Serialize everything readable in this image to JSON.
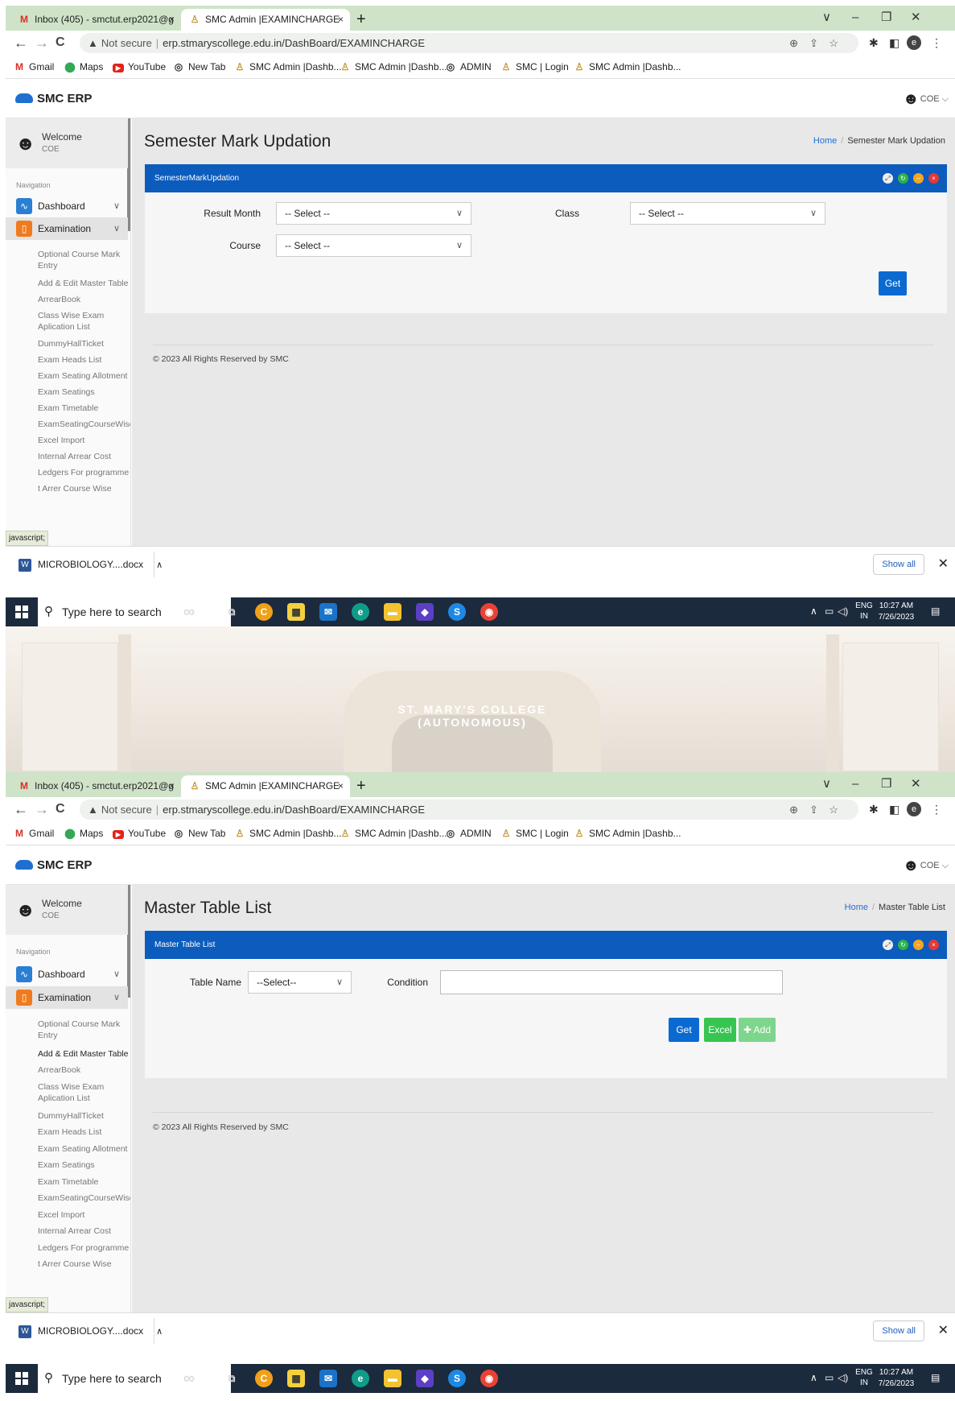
{
  "browser": {
    "tabs": [
      {
        "label": "Inbox (405) - smctut.erp2021@g",
        "close": "×"
      },
      {
        "label": "SMC Admin |EXAMINCHARGE",
        "close": "×"
      }
    ],
    "new_tab": "+",
    "window_controls": [
      "∨",
      "–",
      "❐",
      "✕"
    ],
    "nav": {
      "back": "←",
      "forward": "→",
      "reload": "C"
    },
    "not_secure": "Not secure",
    "url": "erp.stmaryscollege.edu.in/DashBoard/EXAMINCHARGE",
    "profile_initial": "e",
    "bookmarks": [
      "Gmail",
      "Maps",
      "YouTube",
      "New Tab",
      "SMC Admin |Dashb...",
      "SMC Admin |Dashb...",
      "ADMIN",
      "SMC | Login",
      "SMC Admin |Dashb..."
    ]
  },
  "app": {
    "brand": "SMC ERP",
    "user": "COE"
  },
  "sidebar": {
    "welcome": "Welcome",
    "role": "COE",
    "nav_label": "Navigation",
    "menu": [
      {
        "label": "Dashboard",
        "icon": "pulse-icon"
      },
      {
        "label": "Examination",
        "icon": "book-icon"
      }
    ],
    "exam_items": [
      "Optional Course Mark Entry",
      "Add & Edit Master Table",
      "ArrearBook",
      "Class Wise Exam Aplication List",
      "DummyHallTicket",
      "Exam Heads List",
      "Exam Seating Allotment",
      "Exam Seatings",
      "Exam Timetable",
      "ExamSeatingCourseWiseRep",
      "Excel Import",
      "Internal Arrear Cost",
      "Ledgers For programme",
      "t Arrer Course Wise"
    ]
  },
  "status_text": "javascript;",
  "screen1": {
    "page_title": "Semester Mark Updation",
    "breadcrumb": {
      "home": "Home",
      "current": "Semester Mark Updation"
    },
    "panel_title": "SemesterMarkUpdation",
    "fields": {
      "result_month_label": "Result Month",
      "result_month_value": "-- Select --",
      "class_label": "Class",
      "class_value": "-- Select --",
      "course_label": "Course",
      "course_value": "-- Select --"
    },
    "get_button": "Get"
  },
  "screen2": {
    "page_title": "Master Table List",
    "breadcrumb": {
      "home": "Home",
      "current": "Master Table List"
    },
    "panel_title": "Master Table List",
    "fields": {
      "table_name_label": "Table Name",
      "table_name_value": "--Select--",
      "condition_label": "Condition"
    },
    "buttons": {
      "get": "Get",
      "excel": "Excel",
      "add": "✚ Add"
    }
  },
  "footer": "© 2023 All Rights Reserved by SMC",
  "download": {
    "file": "MICROBIOLOGY....docx",
    "show_all": "Show all",
    "close": "✕"
  },
  "taskbar": {
    "search_placeholder": "Type here to search",
    "lang_top": "ENG",
    "lang_bottom": "IN",
    "time": "10:27 AM",
    "date": "7/26/2023"
  },
  "photo_banner": "ST. MARY'S COLLEGE (AUTONOMOUS)",
  "colors": {
    "panel_header": "#0b5cbd",
    "primary_button": "#0b6ad1",
    "excel_button": "#37c552",
    "add_button": "#7ed58c",
    "tabstrip": "#cfe3c8",
    "taskbar": "#1c2a3d"
  }
}
